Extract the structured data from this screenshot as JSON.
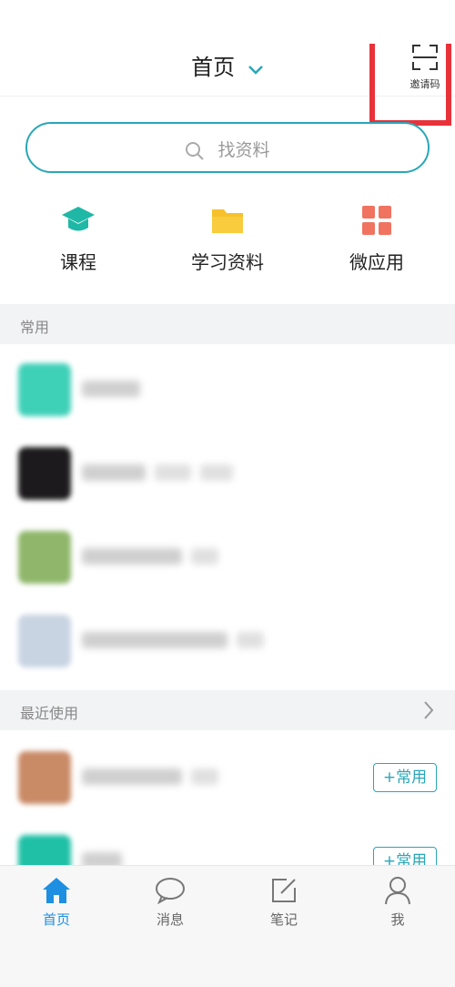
{
  "header": {
    "title": "首页",
    "invite_label": "邀请码"
  },
  "search": {
    "placeholder": "找资料"
  },
  "shortcuts": [
    {
      "label": "课程",
      "icon": "graduation-cap-icon",
      "color": "#1fb8a6"
    },
    {
      "label": "学习资料",
      "icon": "folder-icon",
      "color": "#f6c12c"
    },
    {
      "label": "微应用",
      "icon": "grid-apps-icon",
      "color": "#f07360"
    }
  ],
  "sections": {
    "common": {
      "label": "常用"
    },
    "recent": {
      "label": "最近使用"
    }
  },
  "recent_items": [
    {
      "fav_label": "+常用"
    },
    {
      "fav_label": "+常用"
    }
  ],
  "tabbar": [
    {
      "label": "首页",
      "icon": "home-icon",
      "active": true
    },
    {
      "label": "消息",
      "icon": "chat-bubble-icon",
      "active": false
    },
    {
      "label": "笔记",
      "icon": "note-edit-icon",
      "active": false
    },
    {
      "label": "我",
      "icon": "person-icon",
      "active": false
    }
  ],
  "colors": {
    "accent": "#2aa6b8",
    "tab_active": "#1e8fe1",
    "highlight_box": "#e8323a"
  }
}
